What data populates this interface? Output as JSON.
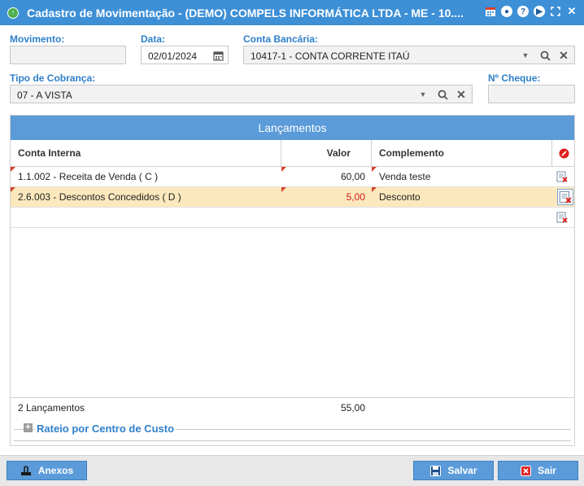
{
  "window": {
    "title": "Cadastro de Movimentação - (DEMO) COMPELS INFORMÁTICA LTDA - ME - 10....",
    "icons": [
      "calendar-icon",
      "chat-icon",
      "help-icon",
      "play-icon",
      "fullscreen-icon",
      "close-icon"
    ]
  },
  "form": {
    "movimento": {
      "label": "Movimento:",
      "value": ""
    },
    "data": {
      "label": "Data:",
      "value": "02/01/2024"
    },
    "conta_bancaria": {
      "label": "Conta Bancária:",
      "value": "10417-1 - CONTA CORRENTE ITAÚ"
    },
    "tipo_cobranca": {
      "label": "Tipo de Cobrança:",
      "value": "07 - A VISTA"
    },
    "cheque": {
      "label": "Nº Cheque:",
      "value": ""
    }
  },
  "grid": {
    "title": "Lançamentos",
    "columns": [
      "Conta Interna",
      "Valor",
      "Complemento"
    ],
    "rows": [
      {
        "conta": "1.1.002 - Receita de Venda ( C )",
        "valor": "60,00",
        "complemento": "Venda teste",
        "selected": false
      },
      {
        "conta": "2.6.003 - Descontos Concedidos ( D )",
        "valor": "5,00",
        "complemento": "Desconto",
        "selected": true
      }
    ],
    "footer": {
      "count": "2 Lançamentos",
      "total": "55,00"
    },
    "colors": {
      "debit_value": "#cc1b1b",
      "selected_row": "#fbe9bd",
      "header": "#5b9bd9"
    }
  },
  "rateio": {
    "label": "Rateio por Centro de Custo"
  },
  "buttons": {
    "anexos": "Anexos",
    "salvar": "Salvar",
    "sair": "Sair"
  }
}
